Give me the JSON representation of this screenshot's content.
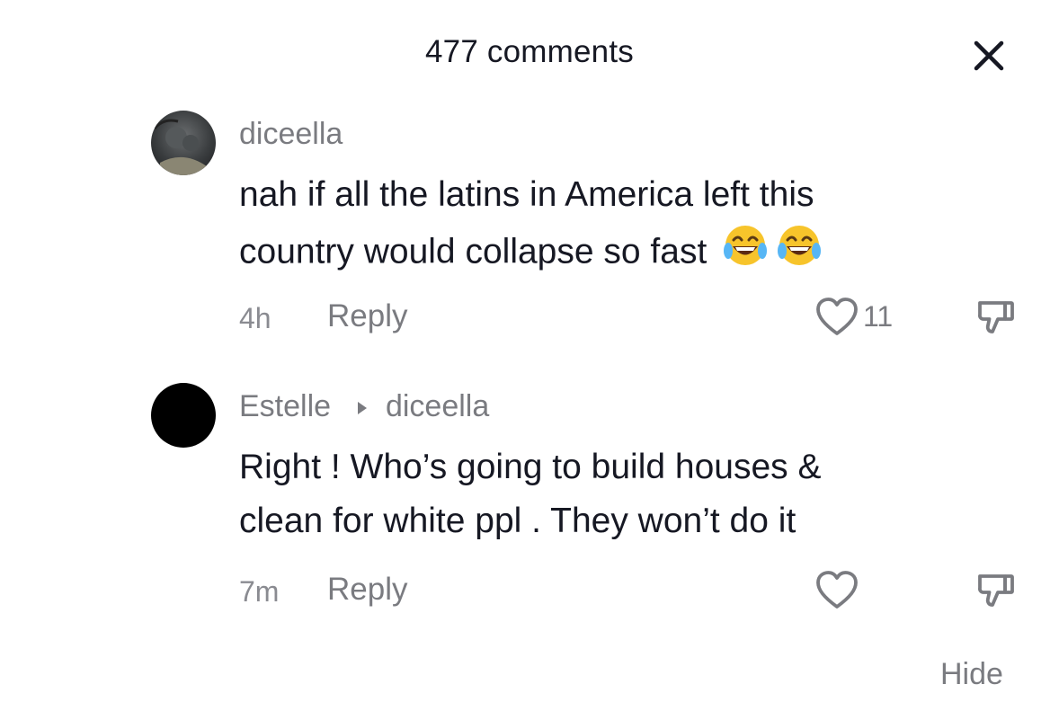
{
  "header": {
    "title": "477 comments"
  },
  "icons": {
    "close": "close-icon",
    "like": "heart-outline-icon",
    "dislike": "thumbs-down-icon",
    "reply_to": "triangle-right-icon",
    "emoji": "face-with-tears-of-joy-emoji"
  },
  "comments": [
    {
      "username": "diceella",
      "text_line1": "nah if all the latins in America left this",
      "text_line2": "country would collapse so fast",
      "emoji": "😂😂",
      "time": "4h",
      "reply_label": "Reply",
      "like_count": "11"
    },
    {
      "username": "Estelle",
      "reply_to": "diceella",
      "text_line1": "Right ! Who’s going to build houses &",
      "text_line2": "clean for white ppl . They won’t do it",
      "time": "7m",
      "reply_label": "Reply"
    }
  ],
  "footer": {
    "hide_label": "Hide"
  },
  "colors": {
    "text": "#161823",
    "secondary": "#7a7b80",
    "background": "#ffffff"
  }
}
